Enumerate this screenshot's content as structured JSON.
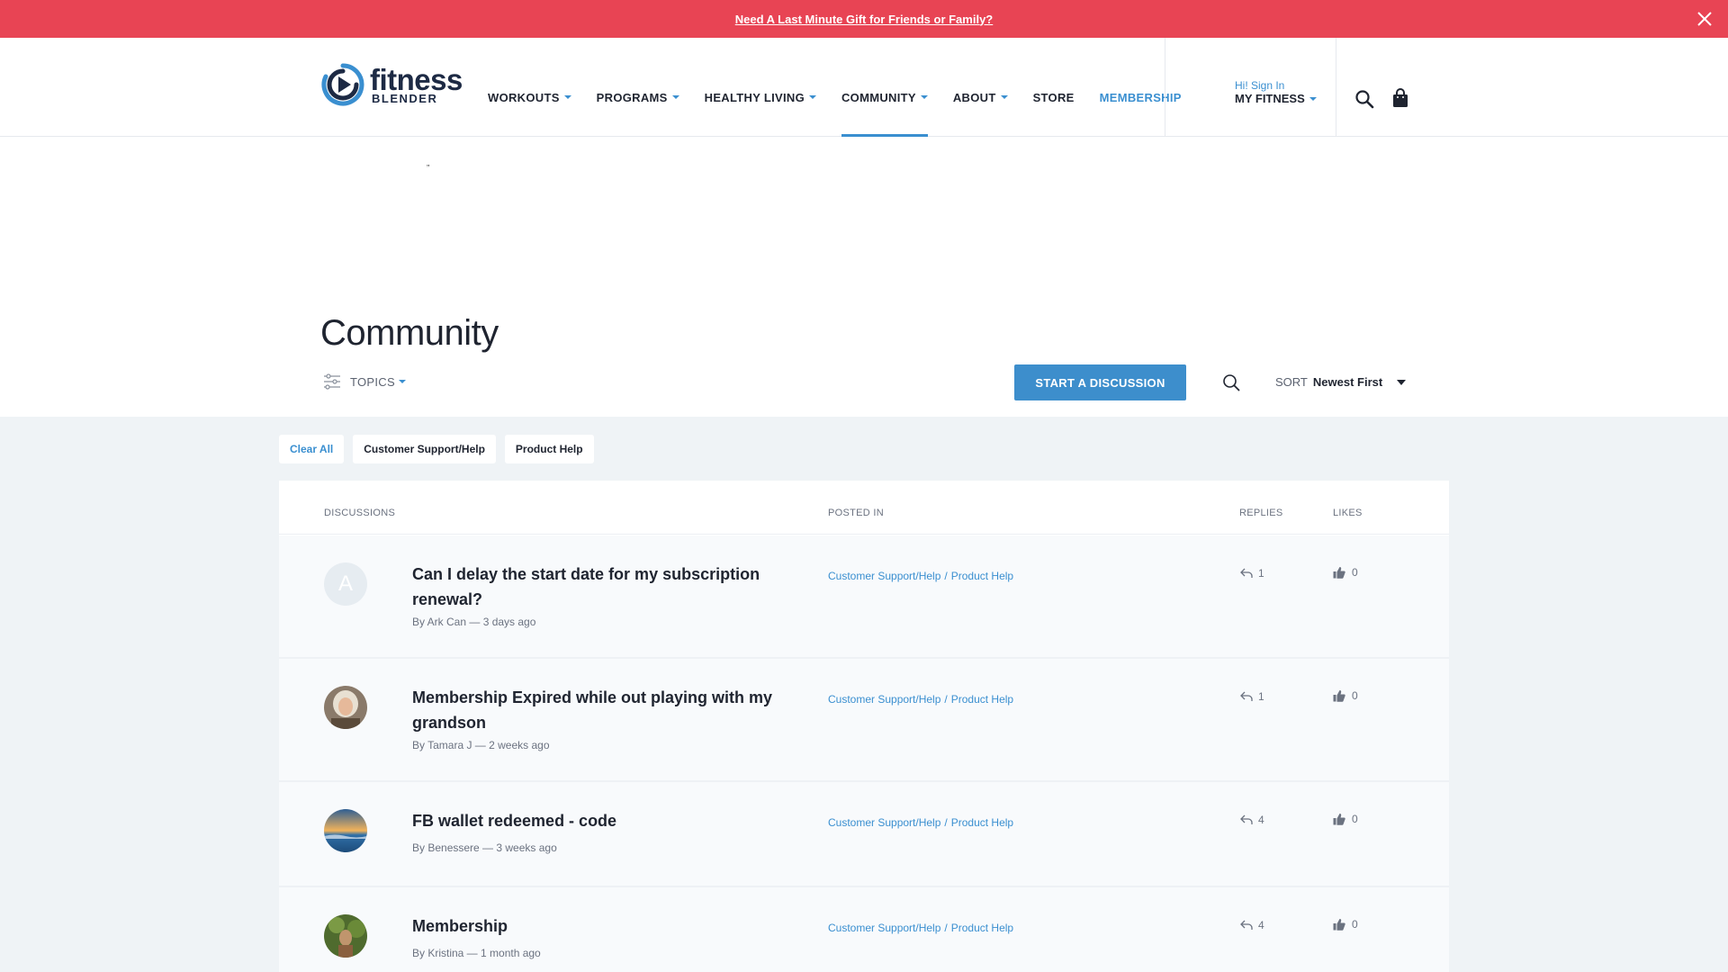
{
  "promo": {
    "text": "Need A Last Minute Gift for Friends or Family?"
  },
  "logo": {
    "line1": "fitness",
    "line2": "BLENDER"
  },
  "nav": {
    "items": [
      {
        "label": "WORKOUTS"
      },
      {
        "label": "PROGRAMS"
      },
      {
        "label": "HEALTHY LIVING"
      },
      {
        "label": "COMMUNITY"
      },
      {
        "label": "ABOUT"
      },
      {
        "label": "STORE"
      },
      {
        "label": "MEMBERSHIP"
      }
    ]
  },
  "account": {
    "greeting": "Hi! Sign In",
    "label": "MY FITNESS"
  },
  "page": {
    "title": "Community",
    "topics_label": "TOPICS",
    "start_label": "START A DISCUSSION",
    "sort_label": "SORT",
    "sort_value": "Newest First",
    "tiny_mark": "„"
  },
  "filters": {
    "clear_label": "Clear All",
    "chips": [
      "Customer Support/Help",
      "Product Help"
    ]
  },
  "table": {
    "headers": {
      "discussions": "DISCUSSIONS",
      "posted_in": "POSTED IN",
      "replies": "REPLIES",
      "likes": "LIKES"
    },
    "rows": [
      {
        "title": "Can I delay the start date for my subscription renewal?",
        "byline": "By Ark Can — 3 days ago",
        "avatar_letter": "A",
        "cat1": "Customer Support/Help",
        "sep": "/",
        "cat2": "Product Help",
        "replies": "1",
        "likes": "0"
      },
      {
        "title": "Membership Expired while out playing with my grandson",
        "byline": "By Tamara J — 2 weeks ago",
        "avatar_letter": "",
        "cat1": "Customer Support/Help",
        "sep": "/",
        "cat2": "Product Help",
        "replies": "1",
        "likes": "0"
      },
      {
        "title": "FB wallet redeemed - code",
        "byline": "By Benessere — 3 weeks ago",
        "avatar_letter": "",
        "cat1": "Customer Support/Help",
        "sep": "/",
        "cat2": "Product Help",
        "replies": "4",
        "likes": "0"
      },
      {
        "title": "Membership",
        "byline": "By Kristina — 1 month ago",
        "avatar_letter": "",
        "cat1": "Customer Support/Help",
        "sep": "/",
        "cat2": "Product Help",
        "replies": "4",
        "likes": "0"
      }
    ]
  },
  "colors": {
    "promo_bg": "#e84454",
    "accent": "#3a8fd0",
    "button": "#3d8ecc",
    "band_bg": "#eff3f6",
    "text": "#1f2430"
  }
}
